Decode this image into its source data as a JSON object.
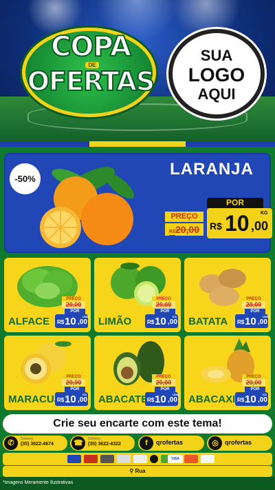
{
  "header": {
    "brand_line1": "COPA",
    "brand_de": "DE",
    "brand_line2": "OFERTAS",
    "logo_placeholder": [
      "SUA",
      "LOGO",
      "AQUI"
    ]
  },
  "hero": {
    "discount": "-50%",
    "product": "LARANJA",
    "preco_label": "PREÇO",
    "old_price_int": "20",
    "old_price_dec": ",00",
    "old_price_cur": "R$",
    "por_label": "POR",
    "currency": "R$",
    "price_int": "10",
    "price_dec": ",00",
    "unit": "KG"
  },
  "products": [
    {
      "name": "ALFACE",
      "preco_label": "PREÇO",
      "old": "20,00",
      "por_label": "POR",
      "cur": "R$",
      "int": "10",
      "dec": ",00",
      "unit": "UNID"
    },
    {
      "name": "LIMÃO",
      "preco_label": "PREÇO",
      "old": "20,00",
      "por_label": "POR",
      "cur": "R$",
      "int": "10",
      "dec": ",00",
      "unit": "KG"
    },
    {
      "name": "BATATA",
      "preco_label": "PREÇO",
      "old": "20,00",
      "por_label": "POR",
      "cur": "R$",
      "int": "10",
      "dec": ",00",
      "unit": "UNID"
    },
    {
      "name": "MARACUJÁ",
      "preco_label": "PREÇO",
      "old": "20,00",
      "por_label": "POR",
      "cur": "R$",
      "int": "10",
      "dec": ",00",
      "unit": "KG"
    },
    {
      "name": "ABACATE",
      "preco_label": "PREÇO",
      "old": "20,00",
      "por_label": "POR",
      "cur": "R$",
      "int": "10",
      "dec": ",00",
      "unit": "UNID"
    },
    {
      "name": "ABACAXI",
      "preco_label": "PREÇO",
      "old": "20,00",
      "por_label": "POR",
      "cur": "R$",
      "int": "10",
      "dec": ",00",
      "unit": "KG"
    }
  ],
  "cta": "Crie seu encarte com este tema!",
  "contacts": [
    {
      "icon": "whatsapp-icon",
      "label": "Delivery",
      "value": "(35) 3622-4674"
    },
    {
      "icon": "phone-icon",
      "label": "Delivery",
      "value": "(35) 3622-4322"
    },
    {
      "icon": "facebook-icon",
      "label": "",
      "value": "qrofertas"
    },
    {
      "icon": "instagram-icon",
      "label": "",
      "value": "qrofertas"
    }
  ],
  "payments": [
    "card",
    "card",
    "card",
    "card",
    "card",
    "card",
    "card",
    "card",
    "VISA",
    "card",
    "card"
  ],
  "address": "Rua",
  "disclaimer": "*Imagens Meramente Ilustrativas",
  "colors": {
    "green": "#0f7a2d",
    "yellow": "#f3d21a",
    "blue": "#2147b6",
    "red": "#c9301c"
  }
}
